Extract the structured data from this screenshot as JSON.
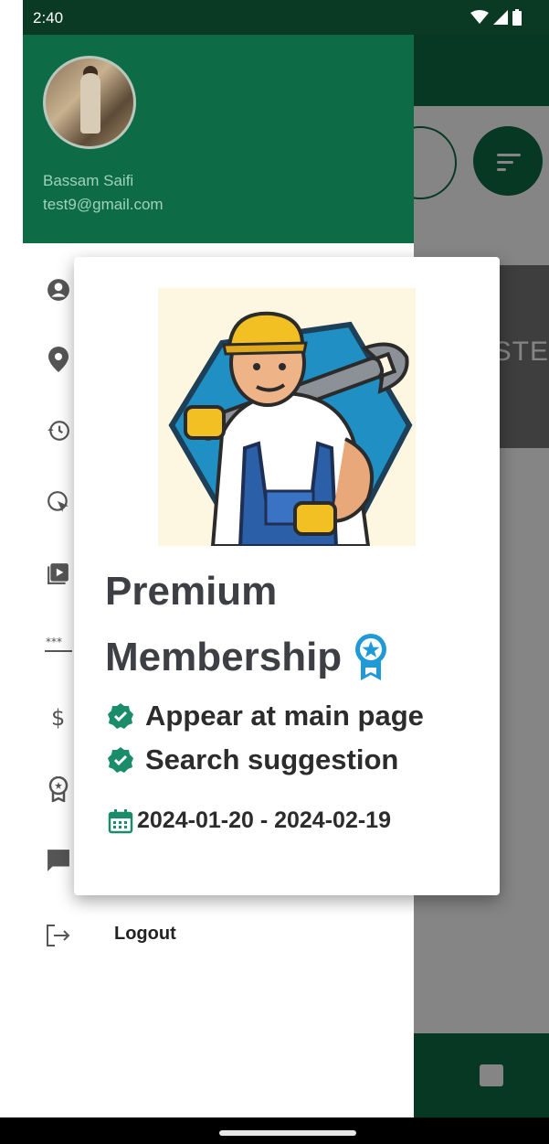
{
  "status_bar": {
    "time": "2:40",
    "icons": [
      "wifi-icon",
      "signal-icon",
      "battery-icon"
    ]
  },
  "drawer": {
    "user_name": "Bassam Saifi",
    "user_email": "test9@gmail.com",
    "menu_icons": [
      "account-icon",
      "location-pin-icon",
      "history-icon",
      "cursor-click-icon",
      "video-library-icon",
      "password-icon",
      "dollar-icon",
      "award-icon",
      "chat-icon",
      "logout-icon"
    ],
    "logout_label": "Logout"
  },
  "background_app": {
    "banner_fragment": "STE"
  },
  "dialog": {
    "title_line1": "Premium",
    "title_line2": "Membership",
    "badge_icon": "award-ribbon-icon",
    "features": [
      "Appear at main page",
      "Search suggestion"
    ],
    "feature_icon": "verified-check-icon",
    "date_range": "2024-01-20 - 2024-02-19",
    "date_icon": "calendar-icon"
  },
  "colors": {
    "primary": "#0d6b45",
    "status_bar": "#0a3a24",
    "accent_teal": "#1b8c6a",
    "badge_blue": "#1f9ad6",
    "title_text": "#3d3f44"
  }
}
